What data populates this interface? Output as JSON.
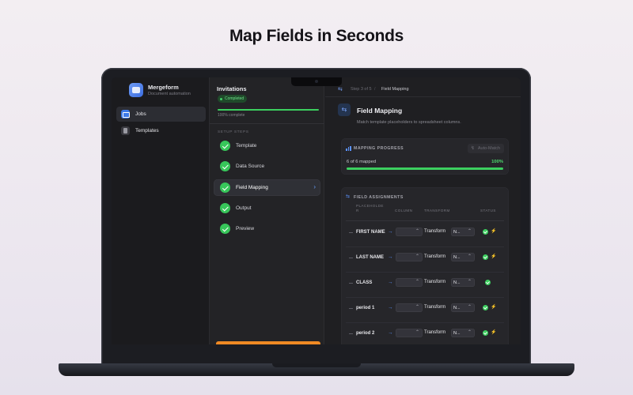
{
  "headline": "Map Fields in Seconds",
  "sidebar": {
    "app_name": "Mergeform",
    "app_subtitle": "Document automation",
    "items": [
      {
        "label": "Jobs",
        "active": true
      },
      {
        "label": "Templates",
        "active": false
      }
    ]
  },
  "job": {
    "title": "Invitations",
    "status": "Completed",
    "progress_fraction": 1.0,
    "progress_text": "100% complete",
    "steps_heading": "SETUP STEPS",
    "steps": [
      {
        "label": "Template",
        "done": true,
        "active": false
      },
      {
        "label": "Data Source",
        "done": true,
        "active": false
      },
      {
        "label": "Field Mapping",
        "done": true,
        "active": true
      },
      {
        "label": "Output",
        "done": true,
        "active": false
      },
      {
        "label": "Preview",
        "done": true,
        "active": false
      }
    ],
    "active_chevron": "›"
  },
  "detail": {
    "breadcrumb_step": "Step 3 of 5",
    "breadcrumb_sep": "/",
    "breadcrumb_current": "Field Mapping",
    "title": "Field Mapping",
    "subtitle": "Match template placeholders to spreadsheet columns.",
    "mapping_progress": {
      "heading": "MAPPING PROGRESS",
      "auto_match_label": "Auto-Match",
      "mapped_text": "6 of 6 mapped",
      "percent_text": "100%",
      "fraction": 1.0
    },
    "assignments": {
      "heading": "FIELD ASSIGNMENTS",
      "columns": {
        "placeholder": "PLACEHOLDE\nR",
        "column": "COLUMN",
        "transform": "TRANSFORM",
        "status": "STATUS"
      },
      "rows": [
        {
          "name": "FIRST NAME",
          "transform": "Transform",
          "transform_value": "N...",
          "bolt": true
        },
        {
          "name": "LAST NAME",
          "transform": "Transform",
          "transform_value": "N...",
          "bolt": true
        },
        {
          "name": "CLASS",
          "transform": "Transform",
          "transform_value": "N...",
          "bolt": false
        },
        {
          "name": "period 1",
          "transform": "Transform",
          "transform_value": "N...",
          "bolt": true
        },
        {
          "name": "period 2",
          "transform": "Transform",
          "transform_value": "N...",
          "bolt": true
        }
      ]
    }
  },
  "icons": {
    "arrow": "→",
    "select_chevron": "⌃",
    "bolt": "⚡",
    "swap": "⇆",
    "wand": "↯"
  },
  "colors": {
    "accent_blue": "#3d7ae8",
    "success_green": "#3ccf5f",
    "primary_orange": "#f08a24"
  }
}
